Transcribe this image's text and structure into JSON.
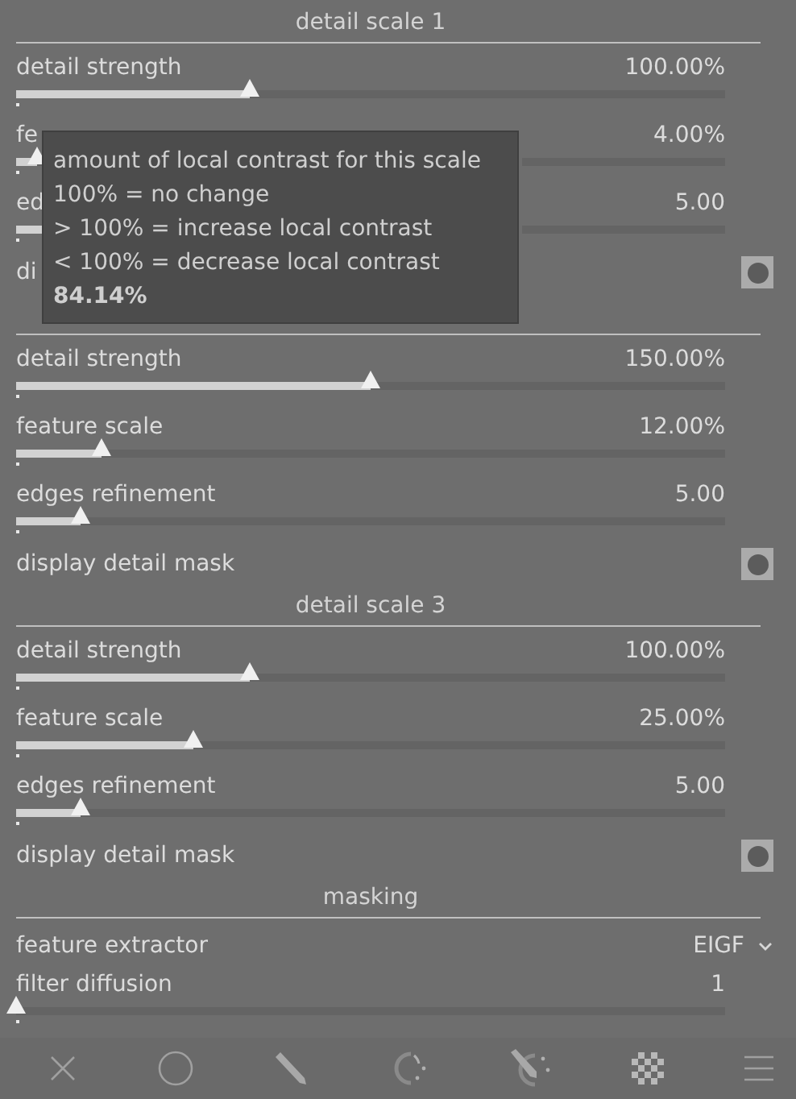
{
  "sections": [
    {
      "title": "detail scale 1",
      "rows": [
        {
          "kind": "slider",
          "label": "detail strength",
          "value": "100.00%",
          "level": 0.33
        },
        {
          "kind": "slider_covered",
          "label": "fe",
          "value": "4.00%",
          "level": 0.03
        },
        {
          "kind": "slider_covered",
          "label": "ed",
          "value": "5.00",
          "level": 0.09
        },
        {
          "kind": "toggle",
          "label": "di"
        }
      ]
    },
    {
      "rows": [
        {
          "kind": "slider",
          "label": "detail strength",
          "value": "150.00%",
          "level": 0.5
        },
        {
          "kind": "slider",
          "label": "feature scale",
          "value": "12.00%",
          "level": 0.12
        },
        {
          "kind": "slider",
          "label": "edges refinement",
          "value": "5.00",
          "level": 0.09
        },
        {
          "kind": "toggle",
          "label": "display detail mask"
        }
      ]
    },
    {
      "title": "detail scale 3",
      "rows": [
        {
          "kind": "slider",
          "label": "detail strength",
          "value": "100.00%",
          "level": 0.33
        },
        {
          "kind": "slider",
          "label": "feature scale",
          "value": "25.00%",
          "level": 0.25
        },
        {
          "kind": "slider",
          "label": "edges refinement",
          "value": "5.00",
          "level": 0.09
        },
        {
          "kind": "toggle",
          "label": "display detail mask"
        }
      ]
    },
    {
      "title": "masking",
      "rows": [
        {
          "kind": "dropdown",
          "label": "feature extractor",
          "value": "EIGF"
        },
        {
          "kind": "slider_compact",
          "label": "filter diffusion",
          "value": "1",
          "level": 0.0
        }
      ]
    }
  ],
  "tooltip": {
    "lines": [
      "amount of local contrast for this scale",
      "100% = no change",
      "> 100% = increase local contrast",
      "< 100% = decrease local contrast"
    ],
    "value": "84.14%"
  },
  "toolbar": [
    {
      "kind": "close"
    },
    {
      "kind": "circle"
    },
    {
      "kind": "pencil"
    },
    {
      "kind": "parametric"
    },
    {
      "kind": "combined"
    },
    {
      "kind": "raster"
    },
    {
      "kind": "menu"
    }
  ]
}
